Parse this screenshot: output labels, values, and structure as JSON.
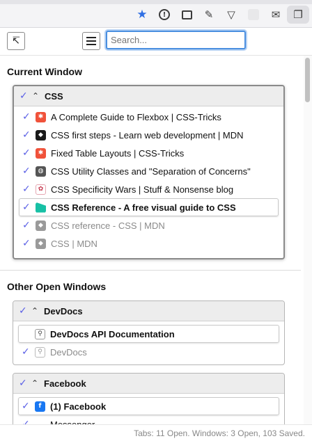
{
  "browser": {
    "toolbar_icons": [
      "star-icon",
      "info-circle-icon",
      "screenshot-frame-icon",
      "pin-icon",
      "pocket-icon",
      "extension-blank-icon",
      "mail-icon",
      "tabs-manager-icon"
    ],
    "accent_color": "#2f6fe4"
  },
  "header": {
    "search_placeholder": "Search...",
    "popout_icon": "popout-arrow-icon",
    "menu_icon": "hamburger-menu-icon"
  },
  "current_window": {
    "section_title": "Current Window",
    "window_name": "CSS",
    "tabs": [
      {
        "title": "A Complete Guide to Flexbox | CSS-Tricks",
        "favicon": "csstricks-icon",
        "state": "open"
      },
      {
        "title": "CSS first steps - Learn web development | MDN",
        "favicon": "mdn-icon",
        "state": "open"
      },
      {
        "title": "Fixed Table Layouts | CSS-Tricks",
        "favicon": "csstricks-icon",
        "state": "open"
      },
      {
        "title": "CSS Utility Classes and \"Separation of Concerns\"",
        "favicon": "globe-icon",
        "state": "open"
      },
      {
        "title": "CSS Specificity Wars | Stuff & Nonsense blog",
        "favicon": "specificity-icon",
        "state": "open"
      },
      {
        "title": "CSS Reference - A free visual guide to CSS",
        "favicon": "cssreference-icon",
        "state": "active"
      },
      {
        "title": "CSS reference - CSS | MDN",
        "favicon": "mdn-icon",
        "state": "closed"
      },
      {
        "title": "CSS | MDN",
        "favicon": "mdn-icon",
        "state": "closed"
      }
    ]
  },
  "other_windows": {
    "section_title": "Other Open Windows",
    "windows": [
      {
        "name": "DevDocs",
        "tabs": [
          {
            "title": "DevDocs API Documentation",
            "favicon": "devdocs-icon",
            "state": "active"
          },
          {
            "title": "DevDocs",
            "favicon": "devdocs-icon",
            "state": "closed"
          }
        ]
      },
      {
        "name": "Facebook",
        "tabs": [
          {
            "title": "(1) Facebook",
            "favicon": "facebook-icon",
            "state": "active"
          },
          {
            "title": "Messenger",
            "favicon": "messenger-icon",
            "state": "closed"
          }
        ]
      }
    ]
  },
  "status": {
    "text": "Tabs: 11 Open. Windows: 3 Open, 103 Saved."
  }
}
